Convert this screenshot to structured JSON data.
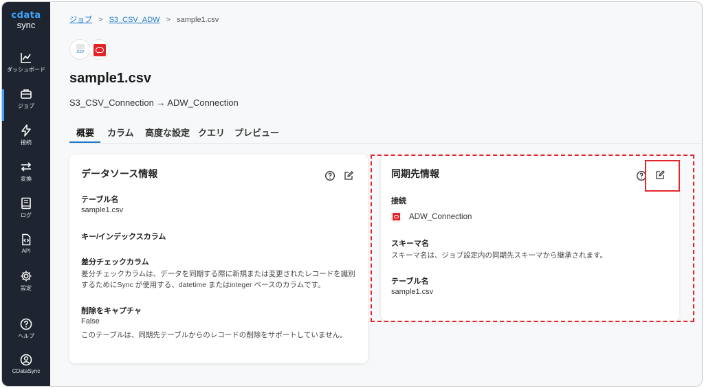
{
  "app": {
    "brand": "cdata",
    "brand_sub": "sync"
  },
  "sidebar": {
    "items": [
      {
        "label": "ダッシュボード",
        "icon": "chart-line-icon"
      },
      {
        "label": "ジョブ",
        "icon": "briefcase-icon",
        "active": true
      },
      {
        "label": "接続",
        "icon": "lightning-icon"
      },
      {
        "label": "変換",
        "icon": "arrows-swap-icon"
      },
      {
        "label": "ログ",
        "icon": "book-icon"
      },
      {
        "label": "API",
        "icon": "code-file-icon"
      },
      {
        "label": "設定",
        "icon": "gear-icon"
      },
      {
        "label": "ヘルプ",
        "icon": "help-circle-icon"
      },
      {
        "label": "CDataSync",
        "icon": "user-icon"
      }
    ]
  },
  "breadcrumb": {
    "items": [
      "ジョブ",
      "S3_CSV_ADW",
      "sample1.csv"
    ],
    "separator": ">"
  },
  "header": {
    "source_icon_label": ".csv",
    "title": "sample1.csv",
    "connection_path": "S3_CSV_Connection → ADW_Connection"
  },
  "tabs": [
    "概要",
    "カラム",
    "高度な設定",
    "クエリ",
    "プレビュー"
  ],
  "source_card": {
    "title": "データソース情報",
    "fields": {
      "table_label": "テーブル名",
      "table_value": "sample1.csv",
      "key_label": "キー/インデックスカラム",
      "diff_label": "差分チェックカラム",
      "diff_desc": "差分チェックカラムは、データを同期する際に新規または変更されたレコードを識別するためにSync が使用する、datetime またはinteger ベースのカラムです。",
      "delete_label": "削除をキャプチャ",
      "delete_value": "False",
      "delete_desc": "このテーブルは、同期先テーブルからのレコードの削除をサポートしていません。"
    }
  },
  "destination_card": {
    "title": "同期先情報",
    "fields": {
      "connection_label": "接続",
      "connection_value": "ADW_Connection",
      "schema_label": "スキーマ名",
      "schema_desc": "スキーマ名は、ジョブ設定内の同期先スキーマから継承されます。",
      "table_label": "テーブル名",
      "table_value": "sample1.csv"
    }
  },
  "colors": {
    "sidebar_bg": "#1e2530",
    "accent": "#1e78c8",
    "oracle_red": "#e32227",
    "highlight": "#e3262b"
  }
}
